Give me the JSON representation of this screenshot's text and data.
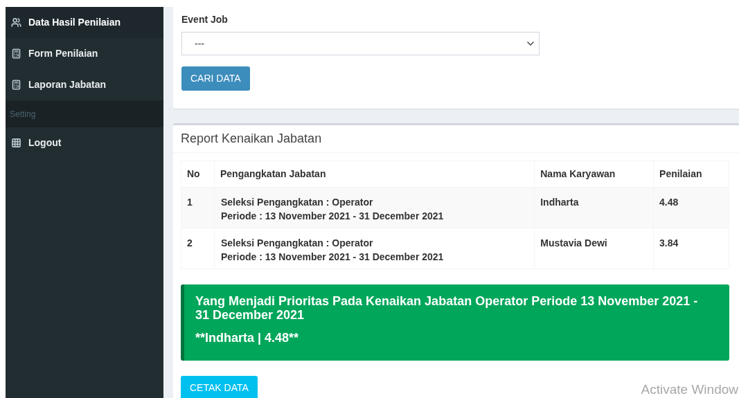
{
  "sidebar": {
    "items": [
      {
        "kind": "item",
        "label": "Data Hasil Penilaian",
        "selected": true
      },
      {
        "kind": "item",
        "label": "Form Penilaian",
        "selected": false
      },
      {
        "kind": "item",
        "label": "Laporan Jabatan",
        "selected": false
      },
      {
        "kind": "header",
        "label": "Setting"
      },
      {
        "kind": "item",
        "label": "Logout",
        "selected": false
      }
    ]
  },
  "filter": {
    "label": "Event Job",
    "select_value": "---",
    "button": "CARI DATA"
  },
  "report": {
    "title": "Report Kenaikan Jabatan",
    "table": {
      "columns": [
        "No",
        "Pengangkatan Jabatan",
        "Nama Karyawan",
        "Penilaian"
      ],
      "rows": [
        {
          "no": "1",
          "position": "Seleksi Pengangkatan : Operator",
          "period": "Periode : 13 November 2021 - 31 December 2021",
          "name": "Indharta",
          "score": "4.48"
        },
        {
          "no": "2",
          "position": "Seleksi Pengangkatan : Operator",
          "period": "Periode : 13 November 2021 - 31 December 2021",
          "name": "Mustavia Dewi",
          "score": "3.84"
        }
      ]
    },
    "alert": {
      "title": "Yang Menjadi Prioritas Pada Kenaikan Jabatan Operator Periode 13 November 2021 - 31 December 2021",
      "result": "**Indharta | 4.48**"
    },
    "print_button": "CETAK DATA"
  },
  "os_notice": "Activate Window"
}
